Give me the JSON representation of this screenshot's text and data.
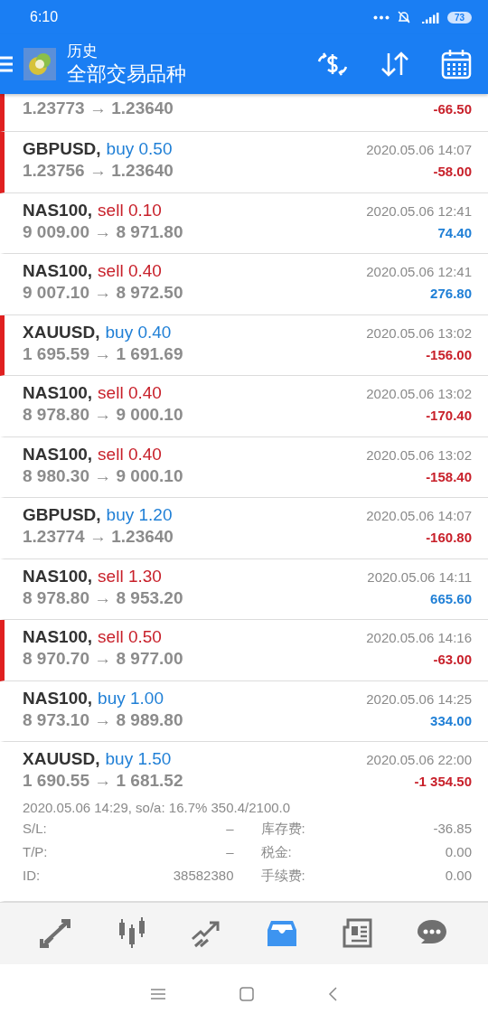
{
  "status_bar": {
    "time": "6:10",
    "battery": "73"
  },
  "header": {
    "title": "历史",
    "subtitle": "全部交易品种"
  },
  "deals": [
    {
      "prices": "1.23773 → 1.23640",
      "profit": "-66.50",
      "color": "#c8202a",
      "marked": true
    },
    {
      "symbol": "GBPUSD,",
      "kind": "buy",
      "action": "buy 0.50",
      "time": "2020.05.06 14:07",
      "prices": "1.23756 → 1.23640",
      "profit": "-58.00",
      "color": "#c8202a",
      "marked": true
    },
    {
      "symbol": "NAS100,",
      "kind": "sell",
      "action": "sell 0.10",
      "time": "2020.05.06 12:41",
      "prices": "9 009.00 → 8 971.80",
      "profit": "74.40",
      "color": "#1f7fd6",
      "marked": false
    },
    {
      "symbol": "NAS100,",
      "kind": "sell",
      "action": "sell 0.40",
      "time": "2020.05.06 12:41",
      "prices": "9 007.10 → 8 972.50",
      "profit": "276.80",
      "color": "#1f7fd6",
      "marked": false
    },
    {
      "symbol": "XAUUSD,",
      "kind": "buy",
      "action": "buy 0.40",
      "time": "2020.05.06 13:02",
      "prices": "1 695.59 → 1 691.69",
      "profit": "-156.00",
      "color": "#c8202a",
      "marked": true
    },
    {
      "symbol": "NAS100,",
      "kind": "sell",
      "action": "sell 0.40",
      "time": "2020.05.06 13:02",
      "prices": "8 978.80 → 9 000.10",
      "profit": "-170.40",
      "color": "#c8202a",
      "marked": false
    },
    {
      "symbol": "NAS100,",
      "kind": "sell",
      "action": "sell 0.40",
      "time": "2020.05.06 13:02",
      "prices": "8 980.30 → 9 000.10",
      "profit": "-158.40",
      "color": "#c8202a",
      "marked": false
    },
    {
      "symbol": "GBPUSD,",
      "kind": "buy",
      "action": "buy 1.20",
      "time": "2020.05.06 14:07",
      "prices": "1.23774 → 1.23640",
      "profit": "-160.80",
      "color": "#c8202a",
      "marked": false
    },
    {
      "symbol": "NAS100,",
      "kind": "sell",
      "action": "sell 1.30",
      "time": "2020.05.06 14:11",
      "prices": "8 978.80 → 8 953.20",
      "profit": "665.60",
      "color": "#1f7fd6",
      "marked": false
    },
    {
      "symbol": "NAS100,",
      "kind": "sell",
      "action": "sell 0.50",
      "time": "2020.05.06 14:16",
      "prices": "8 970.70 → 8 977.00",
      "profit": "-63.00",
      "color": "#c8202a",
      "marked": true
    },
    {
      "symbol": "NAS100,",
      "kind": "buy",
      "action": "buy 1.00",
      "time": "2020.05.06 14:25",
      "prices": "8 973.10 → 8 989.80",
      "profit": "334.00",
      "color": "#1f7fd6",
      "marked": false
    },
    {
      "symbol": "XAUUSD,",
      "kind": "buy",
      "action": "buy 1.50",
      "time": "2020.05.06 22:00",
      "prices": "1 690.55 → 1 681.52",
      "profit": "-1 354.50",
      "color": "#c8202a",
      "marked": false,
      "details": {
        "summary": "2020.05.06 14:29, so/a: 16.7% 350.4/2100.0",
        "fields": [
          {
            "label": "S/L:",
            "value": "–"
          },
          {
            "label": "库存费:",
            "value": "-36.85"
          },
          {
            "label": "T/P:",
            "value": "–"
          },
          {
            "label": "税金:",
            "value": "0.00"
          },
          {
            "label": "ID:",
            "value": "38582380"
          },
          {
            "label": "手续费:",
            "value": "0.00"
          }
        ]
      }
    }
  ],
  "bottom_nav": [
    {
      "kind": "quotes",
      "selected": false
    },
    {
      "kind": "chart",
      "selected": false
    },
    {
      "kind": "trade",
      "selected": false
    },
    {
      "kind": "history",
      "selected": true
    },
    {
      "kind": "news",
      "selected": false
    },
    {
      "kind": "chat",
      "selected": false
    }
  ]
}
